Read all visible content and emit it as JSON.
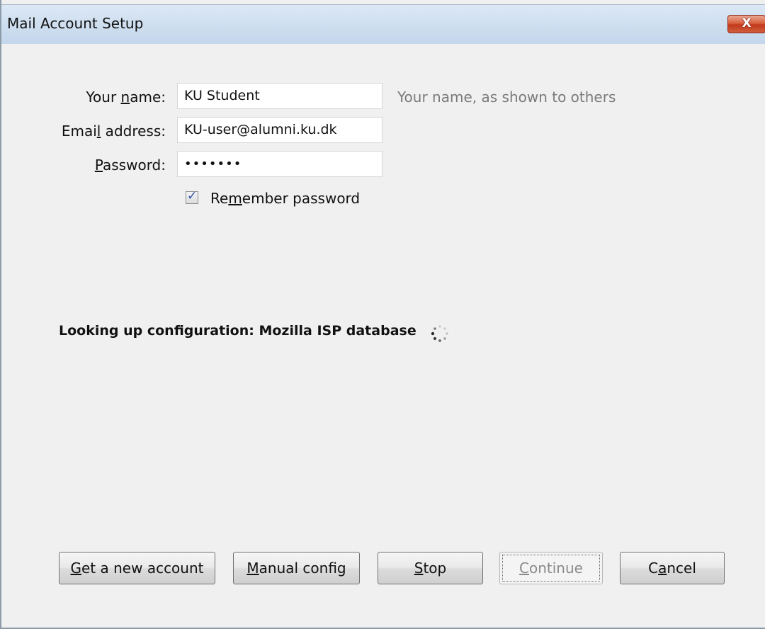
{
  "window": {
    "title": "Mail Account Setup",
    "close_label": "X"
  },
  "form": {
    "name": {
      "label_pre": "Your ",
      "label_accel": "n",
      "label_post": "ame:",
      "value": "KU Student",
      "hint": "Your name, as shown to others"
    },
    "email": {
      "label_pre": "Emai",
      "label_accel": "l",
      "label_post": " address:",
      "value": "KU-user@alumni.ku.dk"
    },
    "password": {
      "label_pre": "",
      "label_accel": "P",
      "label_post": "assword:",
      "value": "•••••••"
    },
    "remember": {
      "label_pre": "Re",
      "label_accel": "m",
      "label_post": "ember password",
      "checked": true,
      "check_glyph": "✓"
    }
  },
  "status": {
    "text": "Looking up configuration: Mozilla ISP database",
    "spinner_icon": "loading-spinner-icon"
  },
  "buttons": {
    "get_new_account": {
      "pre": "",
      "accel": "G",
      "post": "et a new account"
    },
    "manual_config": {
      "pre": "",
      "accel": "M",
      "post": "anual config"
    },
    "stop": {
      "pre": "",
      "accel": "S",
      "post": "top"
    },
    "continue": {
      "pre": "",
      "accel": "C",
      "post": "ontinue",
      "disabled": true
    },
    "cancel": {
      "pre": "C",
      "accel": "a",
      "post": "ncel"
    }
  },
  "colors": {
    "window_bg": "#f0f0f0",
    "titlebar": "#cfdff0",
    "close_button": "#c2391c",
    "hint_text": "#7a7a7a",
    "checkmark": "#3050a8"
  }
}
